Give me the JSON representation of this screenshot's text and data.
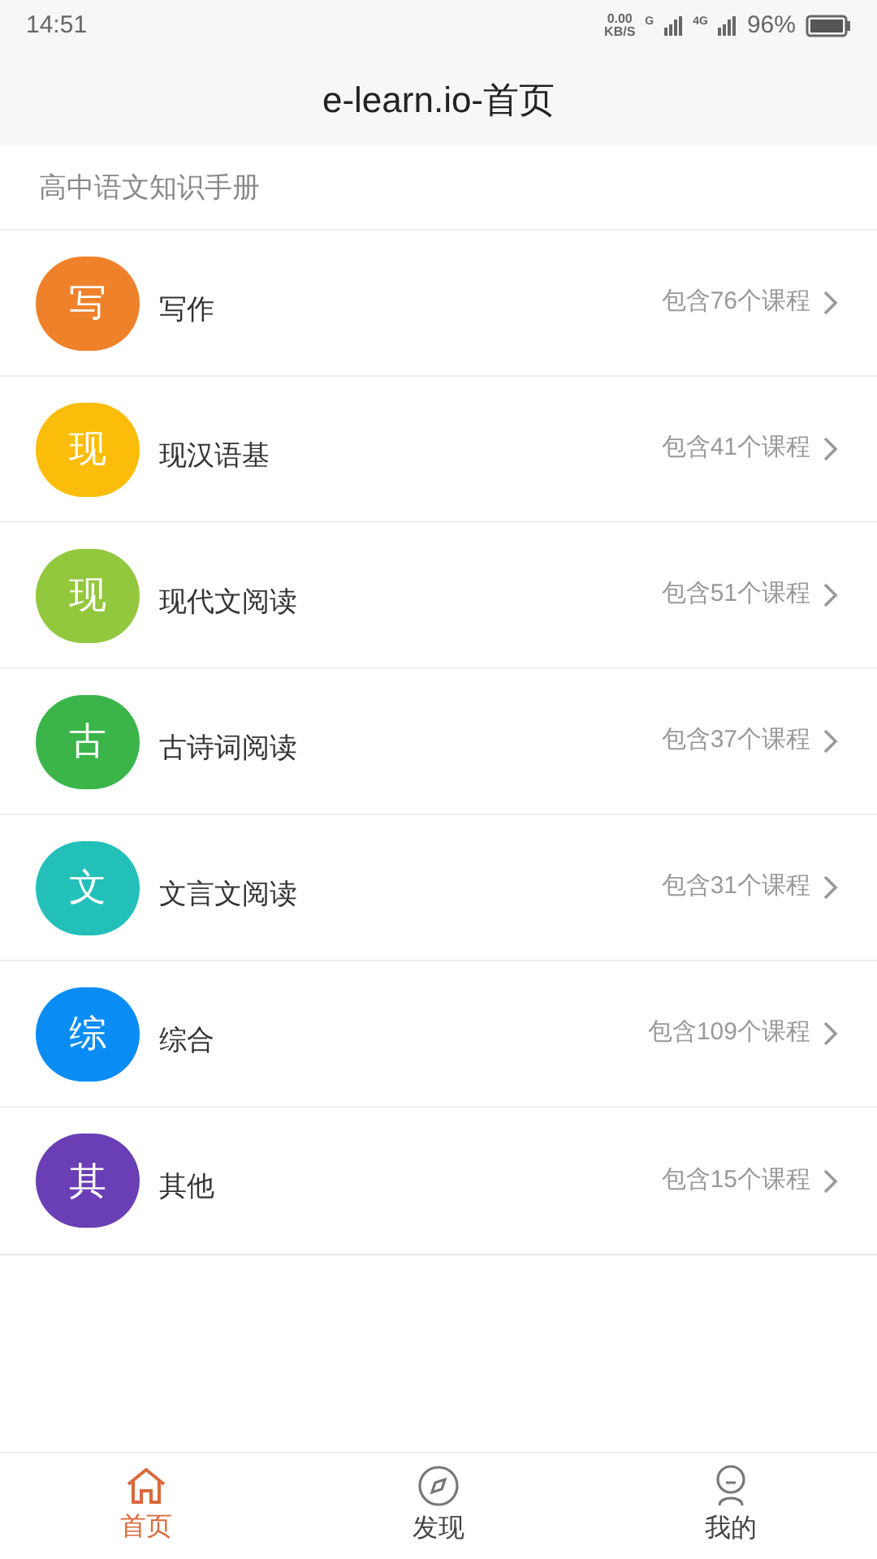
{
  "status_bar": {
    "time": "14:51",
    "speed": "0.00",
    "speed_unit": "KB/S",
    "network_1": "G",
    "network_2": "4G",
    "battery": "96%"
  },
  "header": {
    "title": "e-learn.io-首页"
  },
  "section": {
    "title": "高中语文知识手册"
  },
  "categories": [
    {
      "glyph": "写",
      "name": "写作",
      "count": "包含76个课程",
      "color": "#f0812b"
    },
    {
      "glyph": "现",
      "name": "现汉语基",
      "count": "包含41个课程",
      "color": "#fbbd0a"
    },
    {
      "glyph": "现",
      "name": "现代文阅读",
      "count": "包含51个课程",
      "color": "#93c83e"
    },
    {
      "glyph": "古",
      "name": "古诗词阅读",
      "count": "包含37个课程",
      "color": "#3bb54a"
    },
    {
      "glyph": "文",
      "name": "文言文阅读",
      "count": "包含31个课程",
      "color": "#22c0b8"
    },
    {
      "glyph": "综",
      "name": "综合",
      "count": "包含109个课程",
      "color": "#0a8cf5"
    },
    {
      "glyph": "其",
      "name": "其他",
      "count": "包含15个课程",
      "color": "#6a3fb5"
    }
  ],
  "tabs": [
    {
      "kind": "home",
      "label": "首页",
      "selected": true
    },
    {
      "kind": "discover",
      "label": "发现",
      "selected": false
    },
    {
      "kind": "profile",
      "label": "我的",
      "selected": false
    }
  ]
}
